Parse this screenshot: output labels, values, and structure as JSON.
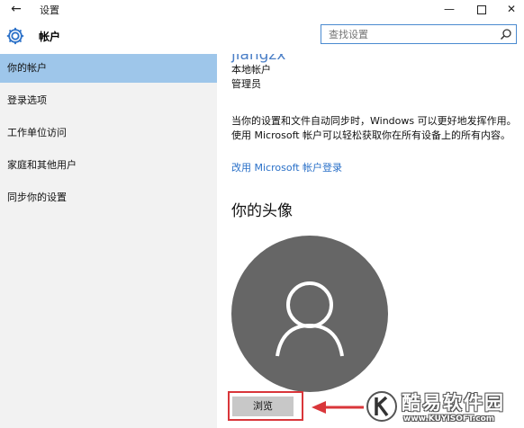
{
  "window": {
    "title": "设置",
    "back_glyph": "←",
    "minimize_glyph": "—",
    "close_glyph": "✕"
  },
  "header": {
    "section_title": "帐户",
    "search": {
      "placeholder": "查找设置",
      "value": ""
    }
  },
  "sidebar": {
    "items": [
      {
        "label": "你的帐户",
        "active": true
      },
      {
        "label": "登录选项",
        "active": false
      },
      {
        "label": "工作单位访问",
        "active": false
      },
      {
        "label": "家庭和其他用户",
        "active": false
      },
      {
        "label": "同步你的设置",
        "active": false
      }
    ]
  },
  "account": {
    "username": "jiangzx",
    "type": "本地帐户",
    "role": "管理员",
    "description": "当你的设置和文件自动同步时，Windows 可以更好地发挥作用。使用 Microsoft 帐户可以轻松获取你在所有设备上的所有内容。",
    "ms_link": "改用 Microsoft 帐户登录"
  },
  "avatar": {
    "heading": "你的头像",
    "browse_label": "浏览"
  },
  "watermark": {
    "name": "酷易软件园",
    "url": "www.KUYISOFT.com"
  },
  "colors": {
    "accent": "#4b7fc7",
    "link": "#2a70c8",
    "sidebar_active": "#9ec6ea",
    "sidebar_bg": "#f2f2f2",
    "avatar_bg": "#666666",
    "highlight": "#d9363a"
  }
}
